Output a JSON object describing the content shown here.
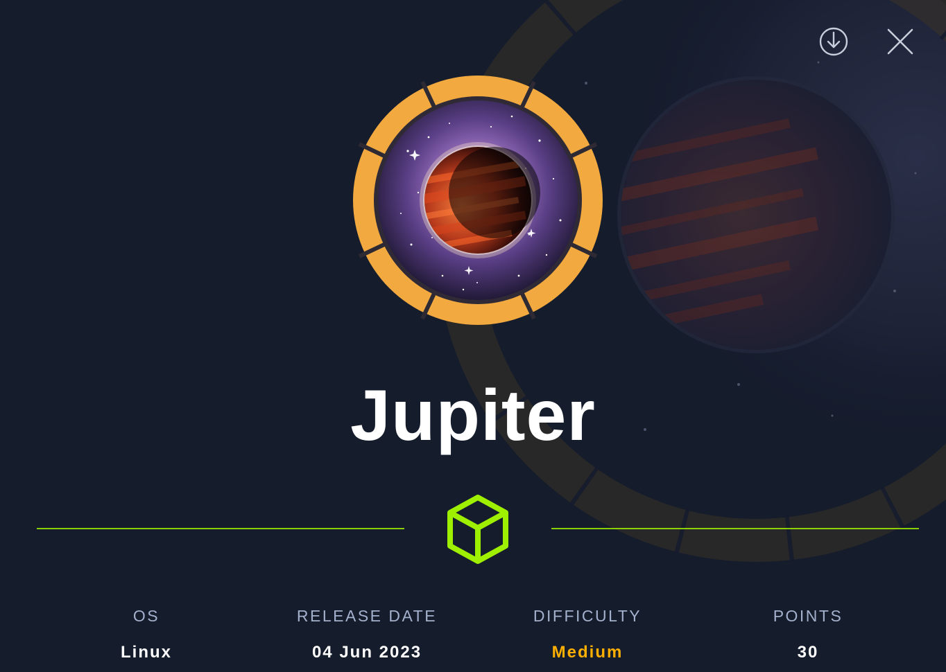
{
  "machine": {
    "name": "Jupiter"
  },
  "actions": {
    "download_icon": "download-icon",
    "close_icon": "close-icon"
  },
  "badge": {
    "icon": "cube-icon",
    "color": "#9fef00"
  },
  "stats": {
    "os": {
      "label": "OS",
      "value": "Linux"
    },
    "release_date": {
      "label": "RELEASE DATE",
      "value": "04 Jun 2023"
    },
    "difficulty": {
      "label": "DIFFICULTY",
      "value": "Medium",
      "color": "#ffaf00"
    },
    "points": {
      "label": "POINTS",
      "value": "30"
    }
  },
  "colors": {
    "background": "#151c2c",
    "avatar_ring": "#f2a93f",
    "accent_green": "#9fef00",
    "label_gray": "#a4b1cd"
  }
}
